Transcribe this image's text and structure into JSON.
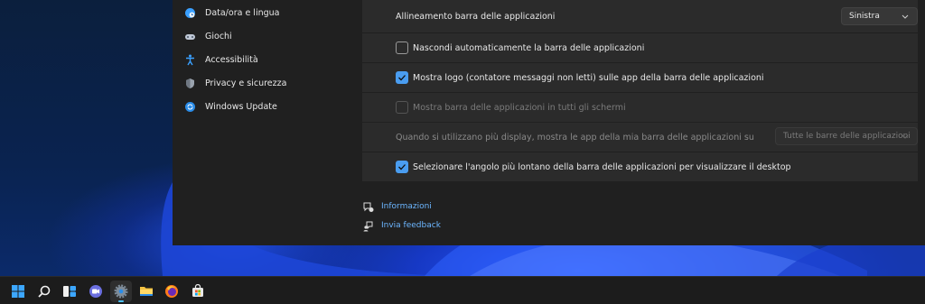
{
  "sidebar": {
    "items": [
      {
        "label": "Data/ora e lingua",
        "icon": "globe-clock-icon"
      },
      {
        "label": "Giochi",
        "icon": "gamepad-icon"
      },
      {
        "label": "Accessibilità",
        "icon": "accessibility-icon"
      },
      {
        "label": "Privacy e sicurezza",
        "icon": "shield-icon"
      },
      {
        "label": "Windows Update",
        "icon": "update-icon"
      }
    ]
  },
  "taskbar_behaviors": {
    "alignment_label": "Allineamento barra delle applicazioni",
    "alignment_value": "Sinistra",
    "autohide_label": "Nascondi automaticamente la barra delle applicazioni",
    "autohide_checked": false,
    "badges_label": "Mostra logo (contatore messaggi non letti) sulle app della barra delle applicazioni",
    "badges_checked": true,
    "all_displays_label": "Mostra barra delle applicazioni in tutti gli schermi",
    "all_displays_checked": false,
    "multi_display_label": "Quando si utilizzano più display, mostra le app della mia barra delle applicazioni su",
    "multi_display_value": "Tutte le barre delle applicazioni",
    "corner_label": "Selezionare l'angolo più lontano della barra delle applicazioni per visualizzare il desktop",
    "corner_checked": true
  },
  "links": {
    "info": "Informazioni",
    "feedback": "Invia feedback"
  },
  "taskbar": {
    "icons": [
      "windows-start-icon",
      "search-icon",
      "widgets-icon",
      "teams-chat-icon",
      "settings-icon",
      "file-explorer-icon",
      "firefox-icon",
      "microsoft-store-icon"
    ],
    "active": "settings-icon"
  },
  "colors": {
    "accent": "#4a9df0",
    "link": "#6cb6ff",
    "window_bg": "#202020",
    "card_bg": "#2b2b2b"
  }
}
